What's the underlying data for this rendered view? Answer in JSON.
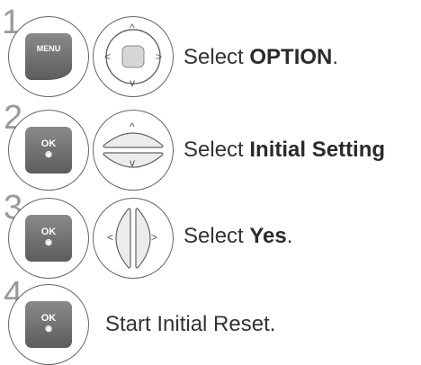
{
  "steps": [
    {
      "number": "1",
      "button": "MENU",
      "text_prefix": "Select ",
      "text_bold": "OPTION",
      "text_suffix": "."
    },
    {
      "number": "2",
      "button": "OK",
      "text_prefix": "Select ",
      "text_bold": "Initial Setting",
      "text_suffix": ""
    },
    {
      "number": "3",
      "button": "OK",
      "text_prefix": "Select ",
      "text_bold": "Yes",
      "text_suffix": "."
    },
    {
      "number": "4",
      "button": "OK",
      "text_prefix": "Start Initial Reset.",
      "text_bold": "",
      "text_suffix": ""
    }
  ],
  "icons": {
    "arrow_up": "^",
    "arrow_down": "v",
    "arrow_left": "<",
    "arrow_right": ">",
    "ok_dot": "◉"
  }
}
